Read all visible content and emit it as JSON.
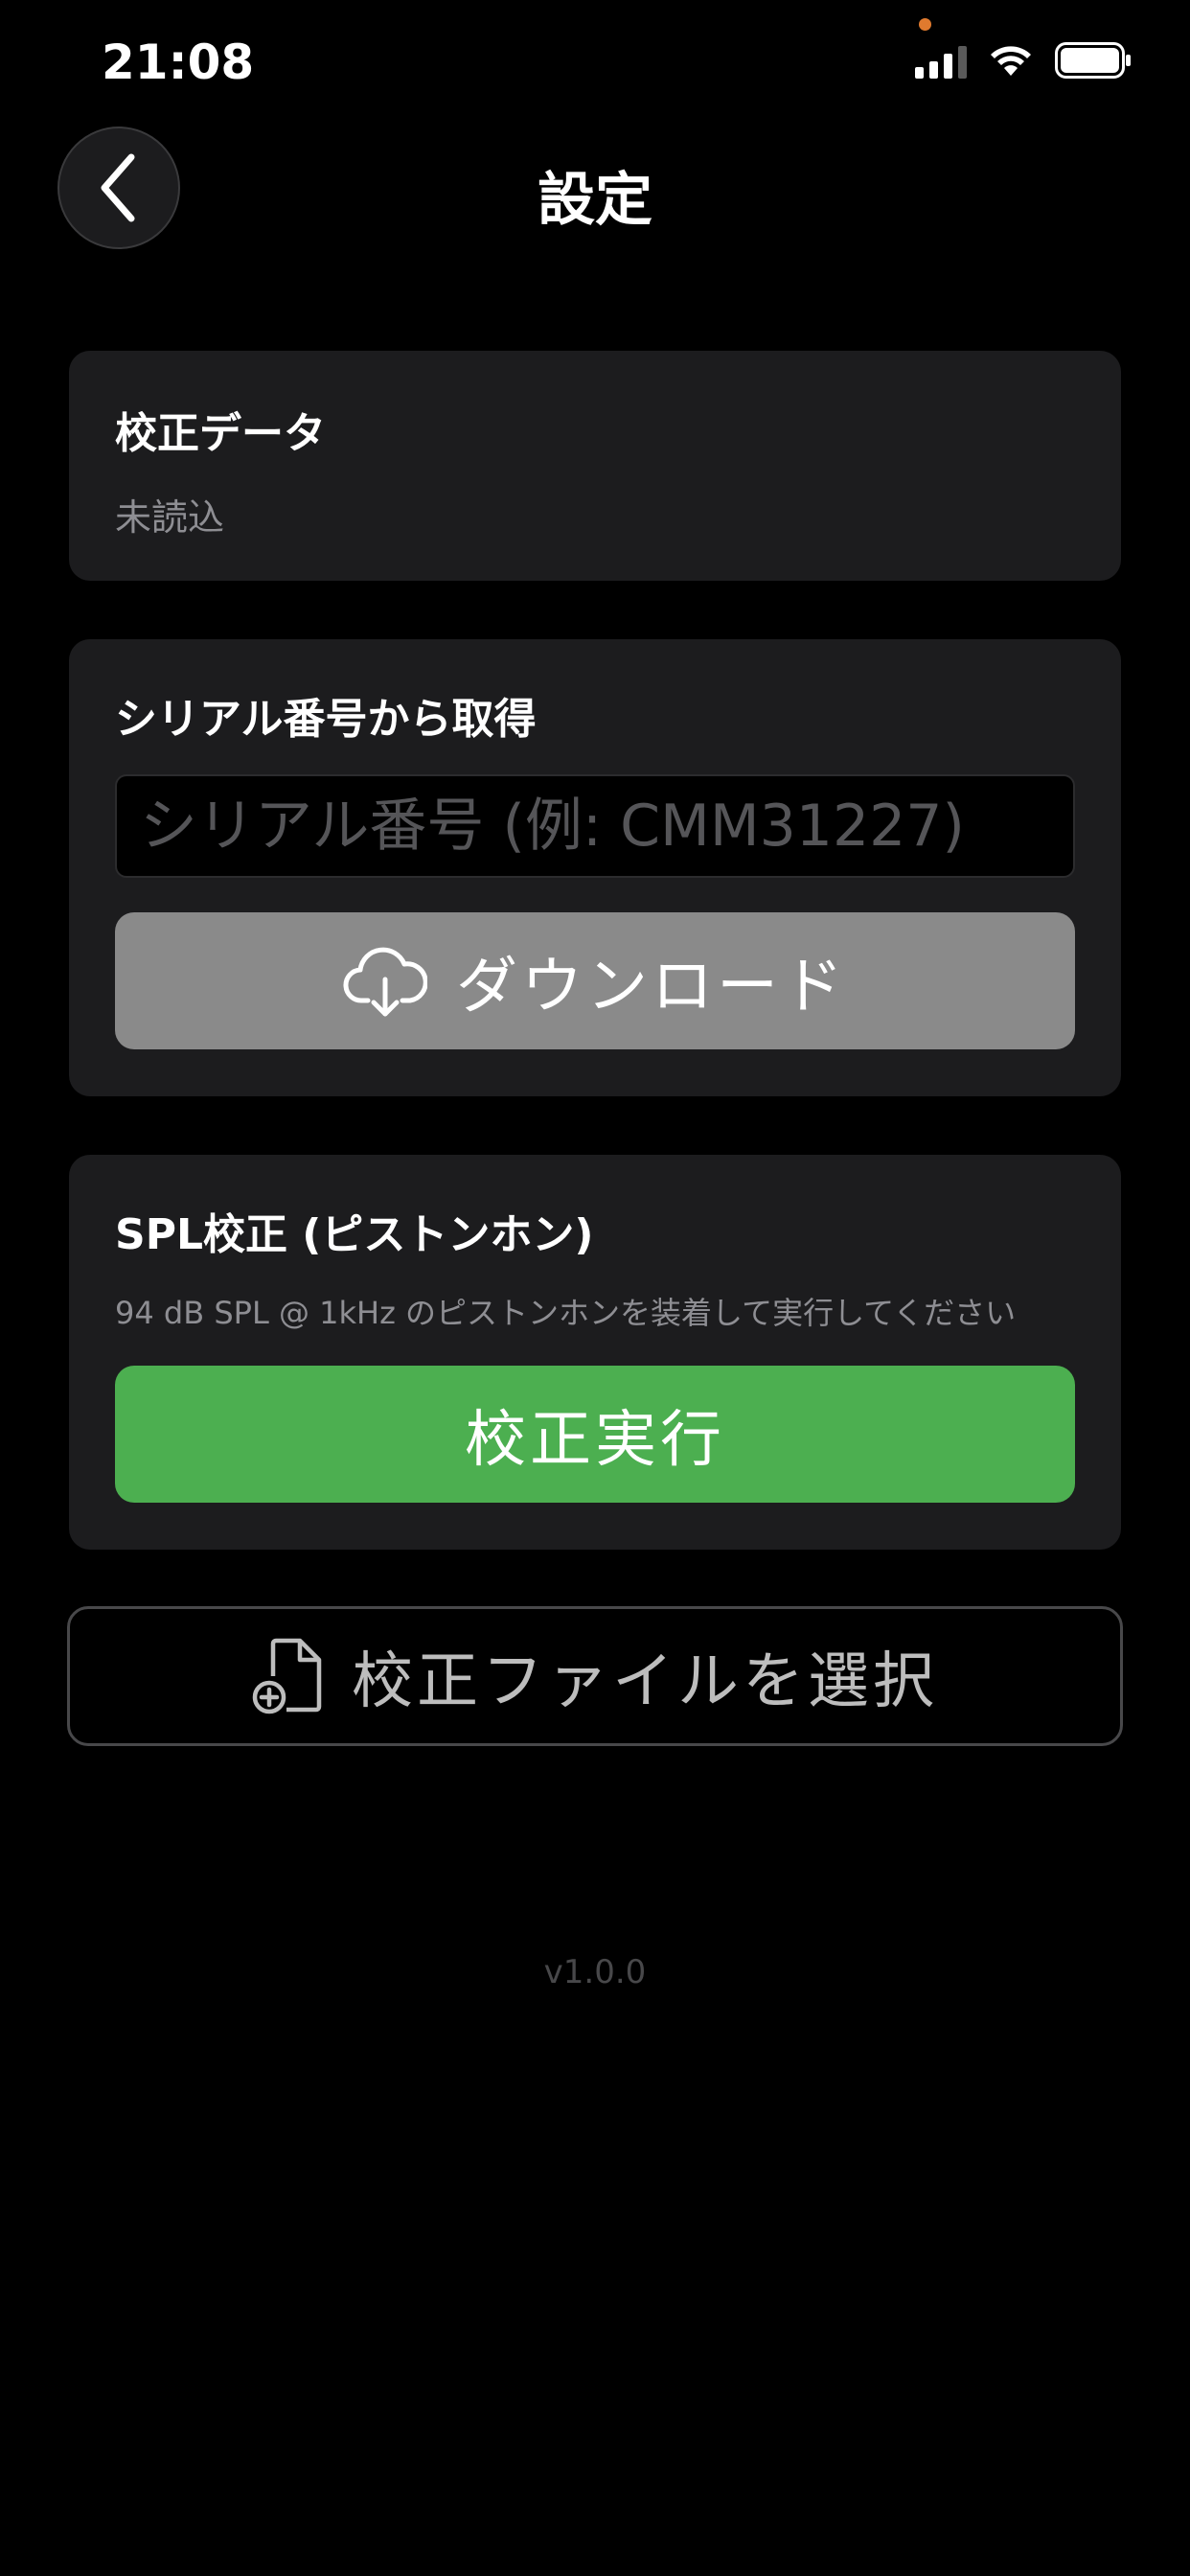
{
  "status_bar": {
    "time": "21:08",
    "privacy_dot_color": "#e07a2e",
    "icons": [
      "cellular-signal-icon",
      "wifi-icon",
      "battery-icon"
    ]
  },
  "header": {
    "back_icon": "chevron-left-icon",
    "title": "設定"
  },
  "calibration_data": {
    "title": "校正データ",
    "status": "未読込"
  },
  "serial": {
    "title": "シリアル番号から取得",
    "input_value": "",
    "input_placeholder": "シリアル番号 (例: CMM31227)",
    "download_icon": "cloud-download-icon",
    "download_label": "ダウンロード",
    "download_button_color": "#8a8a8a"
  },
  "spl": {
    "title": "SPL校正 (ピストンホン)",
    "description": "94 dB SPL @ 1kHz のピストンホンを装着して実行してください",
    "calibrate_label": "校正実行",
    "calibrate_button_color": "#4caf50"
  },
  "select_file": {
    "icon": "file-add-icon",
    "label": "校正ファイルを選択"
  },
  "version": "v1.0.0"
}
